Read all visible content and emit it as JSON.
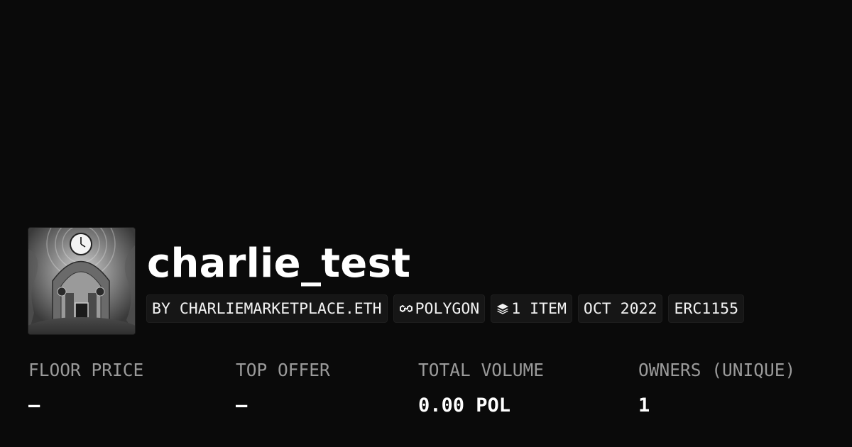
{
  "collection": {
    "name": "charlie_test",
    "avatar": {
      "alt": "charlie_test collection image"
    }
  },
  "tags": {
    "creator": "BY CHARLIEMARKETPLACE.ETH",
    "chain": "POLYGON",
    "chain_icon": "polygon-chain-icon",
    "items": "1 ITEM",
    "items_icon": "layers-icon",
    "created": "OCT 2022",
    "standard": "ERC1155"
  },
  "stats": {
    "floor_price": {
      "label": "FLOOR PRICE",
      "value": "–"
    },
    "top_offer": {
      "label": "TOP OFFER",
      "value": "–"
    },
    "total_volume": {
      "label": "TOTAL VOLUME",
      "value": "0.00 POL"
    },
    "owners": {
      "label": "OWNERS (UNIQUE)",
      "value": "1"
    }
  },
  "colors": {
    "background": "#0a0a0a",
    "tag_background": "#161616",
    "label": "#9a9a9a",
    "text": "#ffffff"
  }
}
